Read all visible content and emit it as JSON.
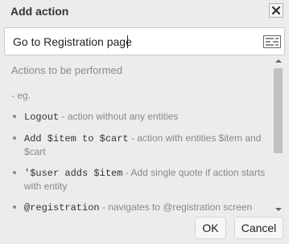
{
  "dialog": {
    "title": "Add action",
    "close_icon": "close-icon"
  },
  "input": {
    "value": "Go to Registration page",
    "list_icon": "list-icon"
  },
  "help": {
    "heading": "Actions to be performed",
    "eg": "- eg.",
    "items": [
      {
        "code": "Logout",
        "text": " - action without any entities"
      },
      {
        "code": "Add $item to $cart",
        "text": " - action with entities $item and $cart"
      },
      {
        "code": "'$user adds $item",
        "text": " - Add single quote if action starts with entity"
      },
      {
        "code": "@registration",
        "text": " - navigates to @registration screen"
      }
    ]
  },
  "buttons": {
    "ok": "OK",
    "cancel": "Cancel"
  },
  "colors": {
    "background": "#ececec",
    "input_bg": "#ffffff",
    "muted_text": "#888888",
    "code_text": "#333333"
  }
}
